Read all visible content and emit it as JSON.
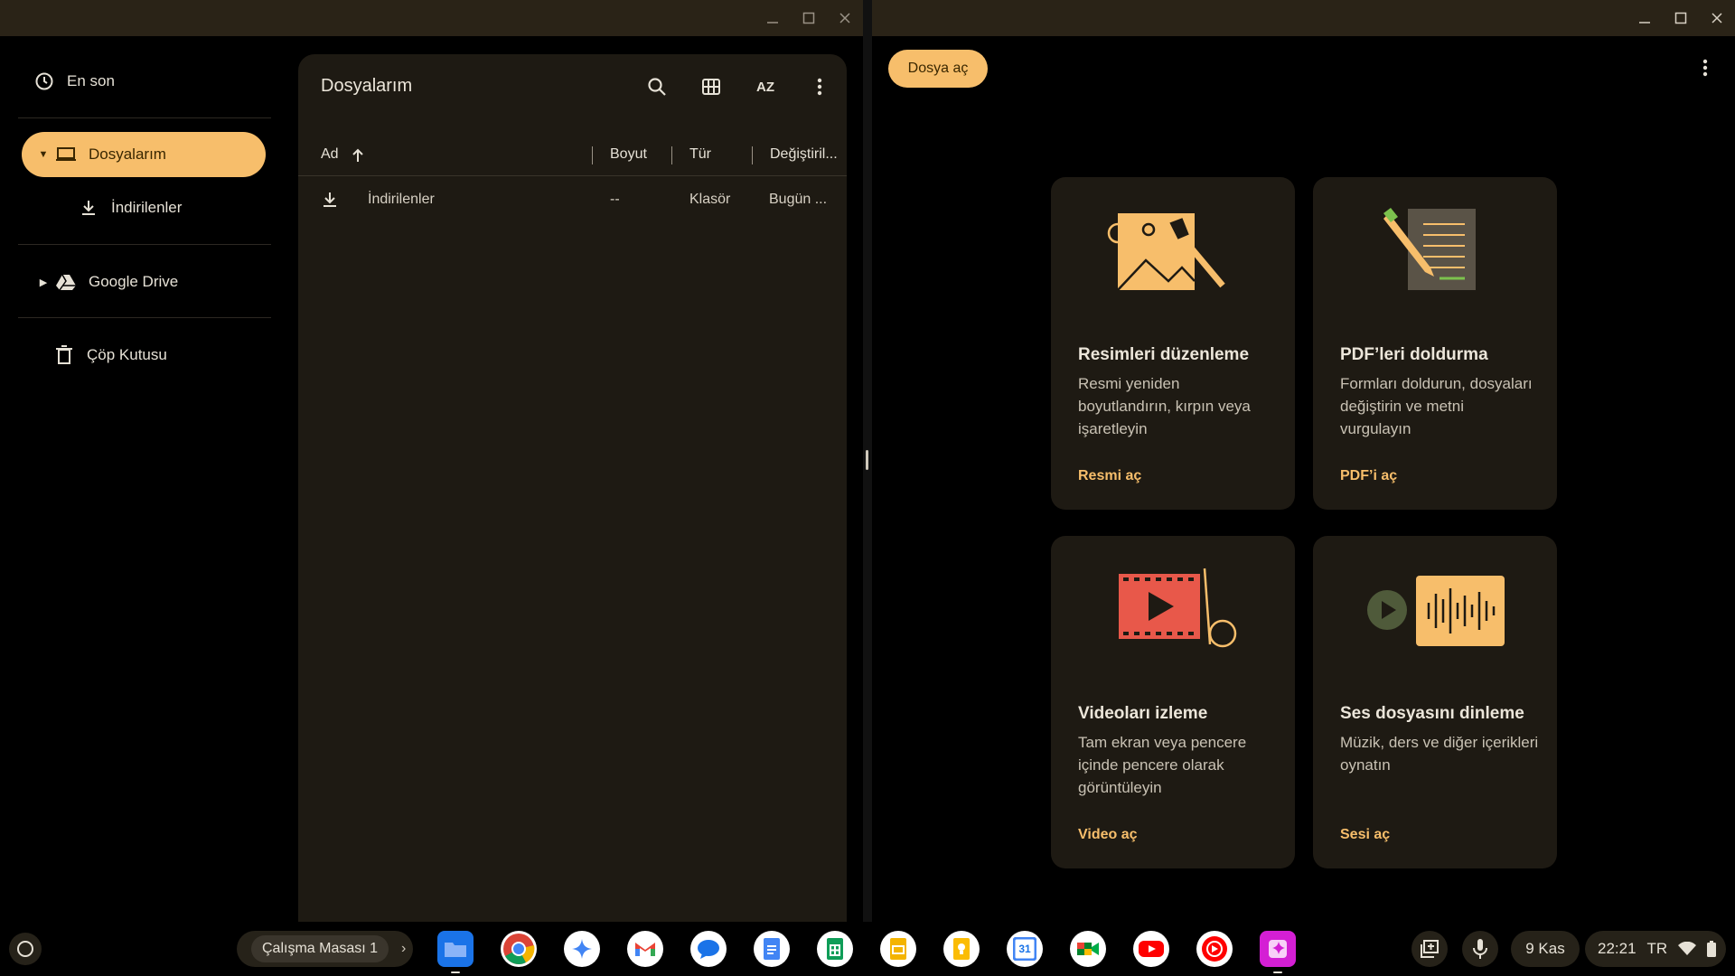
{
  "left_window": {
    "sidebar": {
      "recent": "En son",
      "my_files": "Dosyalarım",
      "downloads": "İndirilenler",
      "google_drive": "Google Drive",
      "trash": "Çöp Kutusu"
    },
    "panel": {
      "title": "Dosyalarım",
      "sort_icon_label": "AZ",
      "columns": {
        "name": "Ad",
        "size": "Boyut",
        "type": "Tür",
        "modified": "Değiştiril..."
      },
      "rows": [
        {
          "name": "İndirilenler",
          "size": "--",
          "type": "Klasör",
          "modified": "Bugün ..."
        }
      ]
    }
  },
  "right_window": {
    "open_button": "Dosya aç",
    "cards": [
      {
        "title": "Resimleri düzenleme",
        "desc": "Resmi yeniden boyutlandırın, kırpın veya işaretleyin",
        "link": "Resmi aç"
      },
      {
        "title": "PDF’leri doldurma",
        "desc": "Formları doldurun, dosyaları değiştirin ve metni vurgulayın",
        "link": "PDF’i aç"
      },
      {
        "title": "Videoları izleme",
        "desc": "Tam ekran veya pencere içinde pencere olarak görüntüleyin",
        "link": "Video aç"
      },
      {
        "title": "Ses dosyasını dinleme",
        "desc": "Müzik, ders ve diğer içerikleri oynatın",
        "link": "Sesi aç"
      }
    ]
  },
  "shelf": {
    "desk_label": "Çalışma Masası 1",
    "calendar_day": "31",
    "date": "9 Kas",
    "time": "22:21",
    "locale": "TR"
  },
  "colors": {
    "accent": "#f7be6b",
    "titlebar": "#2a2317",
    "panel": "#1e1a13"
  }
}
